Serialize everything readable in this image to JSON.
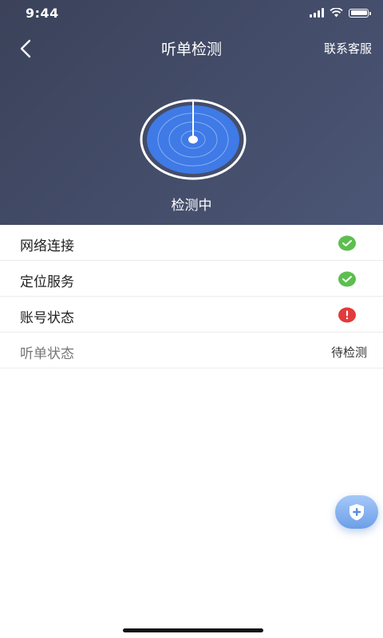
{
  "status_bar": {
    "time": "9:44"
  },
  "nav": {
    "title": "听单检测",
    "contact": "联系客服"
  },
  "radar": {
    "status": "检测中"
  },
  "checks": [
    {
      "label": "网络连接",
      "state": "ok"
    },
    {
      "label": "定位服务",
      "state": "ok"
    },
    {
      "label": "账号状态",
      "state": "error"
    },
    {
      "label": "听单状态",
      "value": "待检测"
    }
  ],
  "colors": {
    "ok": "#5cbf4e",
    "error": "#e23b3b",
    "radar_blue": "#3f7ae6",
    "header": "#3f4660"
  },
  "icons": {
    "back": "chevron-left-icon",
    "ok": "check-circle-icon",
    "error": "exclamation-icon",
    "fab": "plus-shield-icon"
  }
}
